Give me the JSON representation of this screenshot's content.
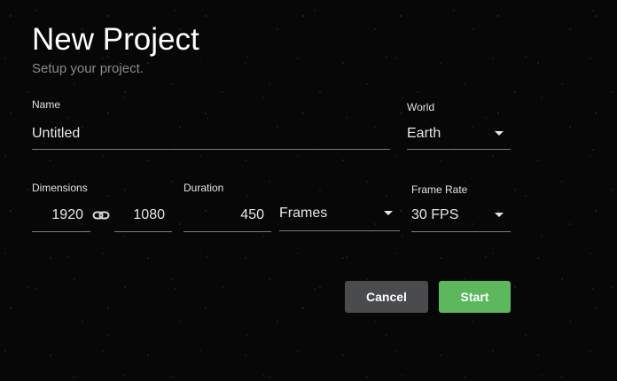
{
  "dialog": {
    "title": "New Project",
    "subtitle": "Setup your project."
  },
  "name": {
    "label": "Name",
    "value": "Untitled"
  },
  "world": {
    "label": "World",
    "value": "Earth",
    "icon": "caret-down-icon"
  },
  "dimensions": {
    "label": "Dimensions",
    "width": "1920",
    "height": "1080",
    "link_icon": "link-icon"
  },
  "duration": {
    "label": "Duration",
    "value": "450",
    "unit": "Frames",
    "icon": "caret-down-icon"
  },
  "frame_rate": {
    "label": "Frame Rate",
    "value": "30 FPS",
    "icon": "caret-down-icon"
  },
  "buttons": {
    "cancel": "Cancel",
    "start": "Start"
  },
  "colors": {
    "background": "#070707",
    "start_button": "#5cb85c",
    "cancel_button": "#4a4b4e",
    "subtitle": "#8a8a8a"
  }
}
